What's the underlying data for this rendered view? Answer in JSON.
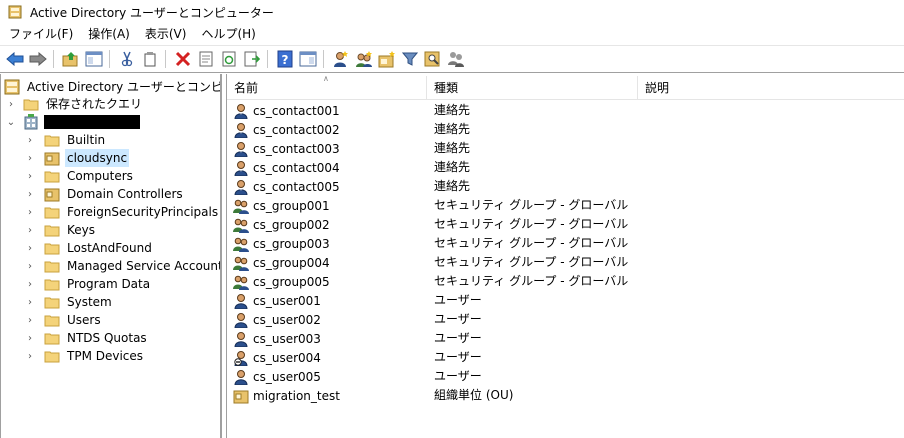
{
  "window": {
    "title": "Active Directory ユーザーとコンピューター"
  },
  "menu": [
    "ファイル(F)",
    "操作(A)",
    "表示(V)",
    "ヘルプ(H)"
  ],
  "toolbar": {
    "buttons": [
      "back-icon",
      "forward-icon",
      "up-folder-icon",
      "show-hide-tree-icon",
      "cut-icon",
      "copy-icon",
      "delete-icon",
      "properties-icon",
      "refresh-icon",
      "export-list-icon",
      "help-icon",
      "show-console-tree-icon",
      "new-user-icon",
      "new-group-icon",
      "new-ou-icon",
      "filter-icon",
      "find-icon",
      "add-member-icon"
    ]
  },
  "tree": {
    "root": "Active Directory ユーザーとコンピューター",
    "saved_queries": "保存されたクエリ",
    "domain_redacted": "",
    "children": [
      "Builtin",
      "cloudsync",
      "Computers",
      "Domain Controllers",
      "ForeignSecurityPrincipals",
      "Keys",
      "LostAndFound",
      "Managed Service Accounts",
      "Program Data",
      "System",
      "Users",
      "NTDS Quotas",
      "TPM Devices"
    ],
    "selected": "cloudsync"
  },
  "list": {
    "columns": [
      "名前",
      "種類",
      "説明"
    ],
    "rows": [
      {
        "name": "cs_contact001",
        "type": "連絡先",
        "icon": "contact-icon"
      },
      {
        "name": "cs_contact002",
        "type": "連絡先",
        "icon": "contact-icon"
      },
      {
        "name": "cs_contact003",
        "type": "連絡先",
        "icon": "contact-icon"
      },
      {
        "name": "cs_contact004",
        "type": "連絡先",
        "icon": "contact-icon"
      },
      {
        "name": "cs_contact005",
        "type": "連絡先",
        "icon": "contact-icon"
      },
      {
        "name": "cs_group001",
        "type": "セキュリティ グループ - グローバル",
        "icon": "group-icon"
      },
      {
        "name": "cs_group002",
        "type": "セキュリティ グループ - グローバル",
        "icon": "group-icon"
      },
      {
        "name": "cs_group003",
        "type": "セキュリティ グループ - グローバル",
        "icon": "group-icon"
      },
      {
        "name": "cs_group004",
        "type": "セキュリティ グループ - グローバル",
        "icon": "group-icon"
      },
      {
        "name": "cs_group005",
        "type": "セキュリティ グループ - グローバル",
        "icon": "group-icon"
      },
      {
        "name": "cs_user001",
        "type": "ユーザー",
        "icon": "user-icon"
      },
      {
        "name": "cs_user002",
        "type": "ユーザー",
        "icon": "user-icon"
      },
      {
        "name": "cs_user003",
        "type": "ユーザー",
        "icon": "user-icon"
      },
      {
        "name": "cs_user004",
        "type": "ユーザー",
        "icon": "disabled-user-icon"
      },
      {
        "name": "cs_user005",
        "type": "ユーザー",
        "icon": "user-icon"
      },
      {
        "name": "migration_test",
        "type": "組織単位 (OU)",
        "icon": "ou-folder-icon"
      }
    ]
  },
  "colors": {
    "selection": "#cce8ff",
    "folder": "#e8c26a",
    "help_blue": "#3b6fd1",
    "delete_red": "#d42121"
  }
}
